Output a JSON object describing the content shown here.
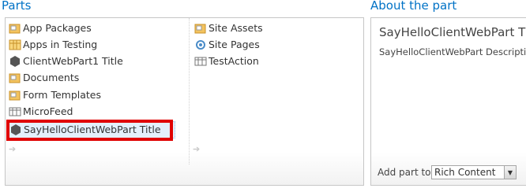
{
  "parts": {
    "title": "Parts",
    "column1": [
      {
        "label": "App Packages",
        "icon": "folder-icon"
      },
      {
        "label": "Apps in Testing",
        "icon": "list-icon"
      },
      {
        "label": "ClientWebPart1 Title",
        "icon": "app-part-icon"
      },
      {
        "label": "Documents",
        "icon": "folder-icon"
      },
      {
        "label": "Form Templates",
        "icon": "folder-icon"
      },
      {
        "label": "MicroFeed",
        "icon": "list-icon"
      },
      {
        "label": "SayHelloClientWebPart Title",
        "icon": "app-part-icon",
        "selected": true
      }
    ],
    "column2": [
      {
        "label": "Site Assets",
        "icon": "folder-icon"
      },
      {
        "label": "Site Pages",
        "icon": "pages-icon"
      },
      {
        "label": "TestAction",
        "icon": "list-icon"
      }
    ]
  },
  "about": {
    "title": "About the part",
    "part_name": "SayHelloClientWebPart Title",
    "part_description": "SayHelloClientWebPart Description",
    "add_part_label": "Add part to:",
    "add_part_value": "Rich Content"
  },
  "colors": {
    "accent": "#0072c6",
    "highlight": "#e00000",
    "selection": "#e4f0fc"
  }
}
